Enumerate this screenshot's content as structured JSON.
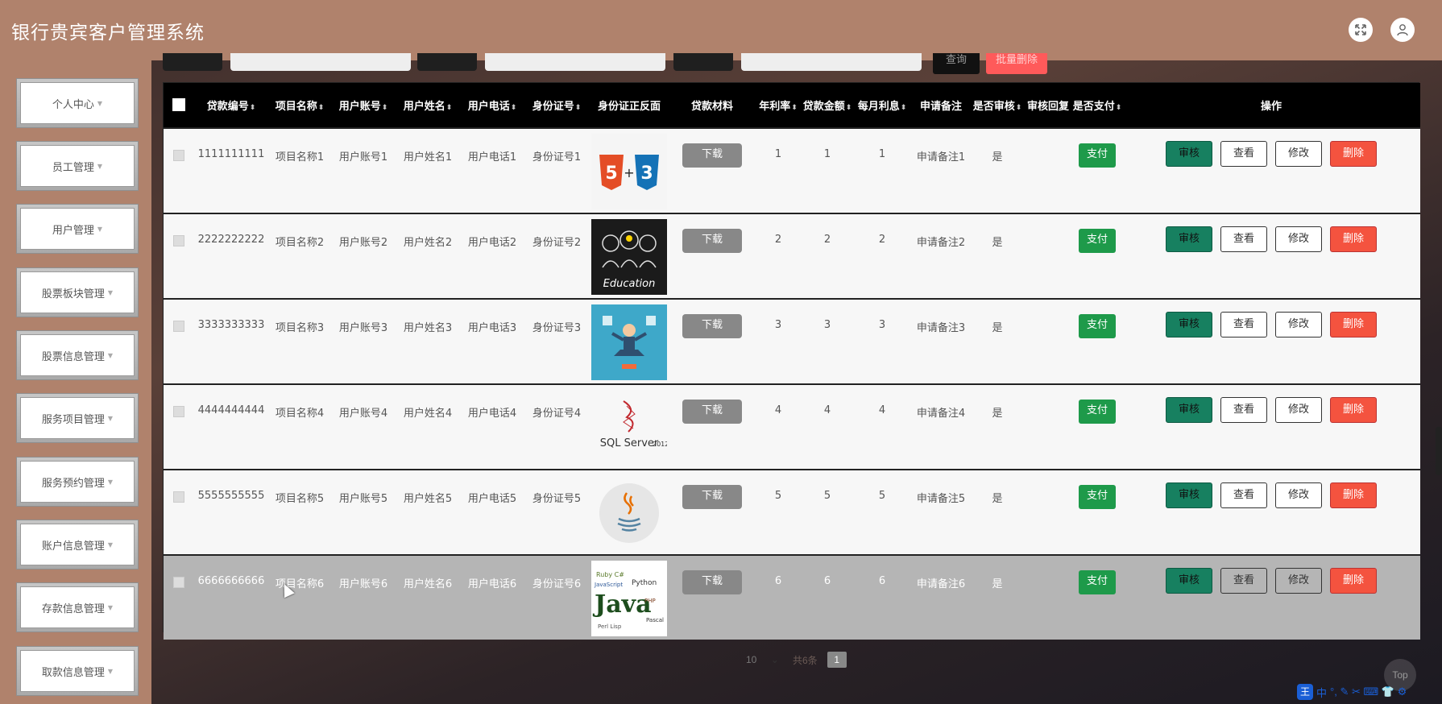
{
  "header": {
    "title": "银行贵宾客户管理系统",
    "expand_icon": "expand-icon",
    "user_icon": "user-icon"
  },
  "sidebar": {
    "items": [
      {
        "label": "个人中心"
      },
      {
        "label": "员工管理"
      },
      {
        "label": "用户管理"
      },
      {
        "label": "股票板块管理"
      },
      {
        "label": "股票信息管理"
      },
      {
        "label": "服务项目管理"
      },
      {
        "label": "服务预约管理"
      },
      {
        "label": "账户信息管理"
      },
      {
        "label": "存款信息管理"
      },
      {
        "label": "取款信息管理"
      }
    ]
  },
  "toolbar": {
    "query_label": "查询",
    "bulk_delete_label": "批量删除"
  },
  "table": {
    "columns": {
      "loan_no": "贷款编号",
      "project": "项目名称",
      "account": "用户账号",
      "name": "用户姓名",
      "phone": "用户电话",
      "id_no": "身份证号",
      "id_img": "身份证正反面",
      "material": "贷款材料",
      "rate": "年利率",
      "amount": "贷款金额",
      "interest": "每月利息",
      "remark": "申请备注",
      "audited": "是否审核",
      "reply": "审核回复",
      "paid": "是否支付",
      "ops": "操作"
    },
    "labels": {
      "download": "下载",
      "pay": "支付",
      "audit": "审核",
      "view": "查看",
      "edit": "修改",
      "delete": "删除"
    },
    "rows": [
      {
        "loan_no": "1111111111",
        "project": "项目名称1",
        "account": "用户账号1",
        "name": "用户姓名1",
        "phone": "用户电话1",
        "id_no": "身份证号1",
        "image": "html5-css3-logo",
        "rate": "1",
        "amount": "1",
        "interest": "1",
        "remark": "申请备注1",
        "audited": "是",
        "reply": ""
      },
      {
        "loan_no": "2222222222",
        "project": "项目名称2",
        "account": "用户账号2",
        "name": "用户姓名2",
        "phone": "用户电话2",
        "id_no": "身份证号2",
        "image": "education-chalkboard",
        "img_text": "Education",
        "rate": "2",
        "amount": "2",
        "interest": "2",
        "remark": "申请备注2",
        "audited": "是",
        "reply": ""
      },
      {
        "loan_no": "3333333333",
        "project": "项目名称3",
        "account": "用户账号3",
        "name": "用户姓名3",
        "phone": "用户电话3",
        "id_no": "身份证号3",
        "image": "meditating-person-illustration",
        "rate": "3",
        "amount": "3",
        "interest": "3",
        "remark": "申请备注3",
        "audited": "是",
        "reply": ""
      },
      {
        "loan_no": "4444444444",
        "project": "项目名称4",
        "account": "用户账号4",
        "name": "用户姓名4",
        "phone": "用户电话4",
        "id_no": "身份证号4",
        "image": "sql-server-logo",
        "img_text": "SQL Server 2012",
        "rate": "4",
        "amount": "4",
        "interest": "4",
        "remark": "申请备注4",
        "audited": "是",
        "reply": ""
      },
      {
        "loan_no": "5555555555",
        "project": "项目名称5",
        "account": "用户账号5",
        "name": "用户姓名5",
        "phone": "用户电话5",
        "id_no": "身份证号5",
        "image": "java-coffee-logo",
        "rate": "5",
        "amount": "5",
        "interest": "5",
        "remark": "申请备注5",
        "audited": "是",
        "reply": ""
      },
      {
        "loan_no": "6666666666",
        "project": "项目名称6",
        "account": "用户账号6",
        "name": "用户姓名6",
        "phone": "用户电话6",
        "id_no": "身份证号6",
        "image": "java-word-cloud",
        "img_text": "Java",
        "rate": "6",
        "amount": "6",
        "interest": "6",
        "remark": "申请备注6",
        "audited": "是",
        "reply": ""
      }
    ]
  },
  "pager": {
    "page_size": "10",
    "total": "共6条",
    "current_page": "1"
  },
  "misc": {
    "back_to_top": "Top",
    "ime_logo": "王",
    "ime_mode": "中",
    "ime_tools": "°, ✎ ✂ ⌨ 👕 ⚙"
  }
}
